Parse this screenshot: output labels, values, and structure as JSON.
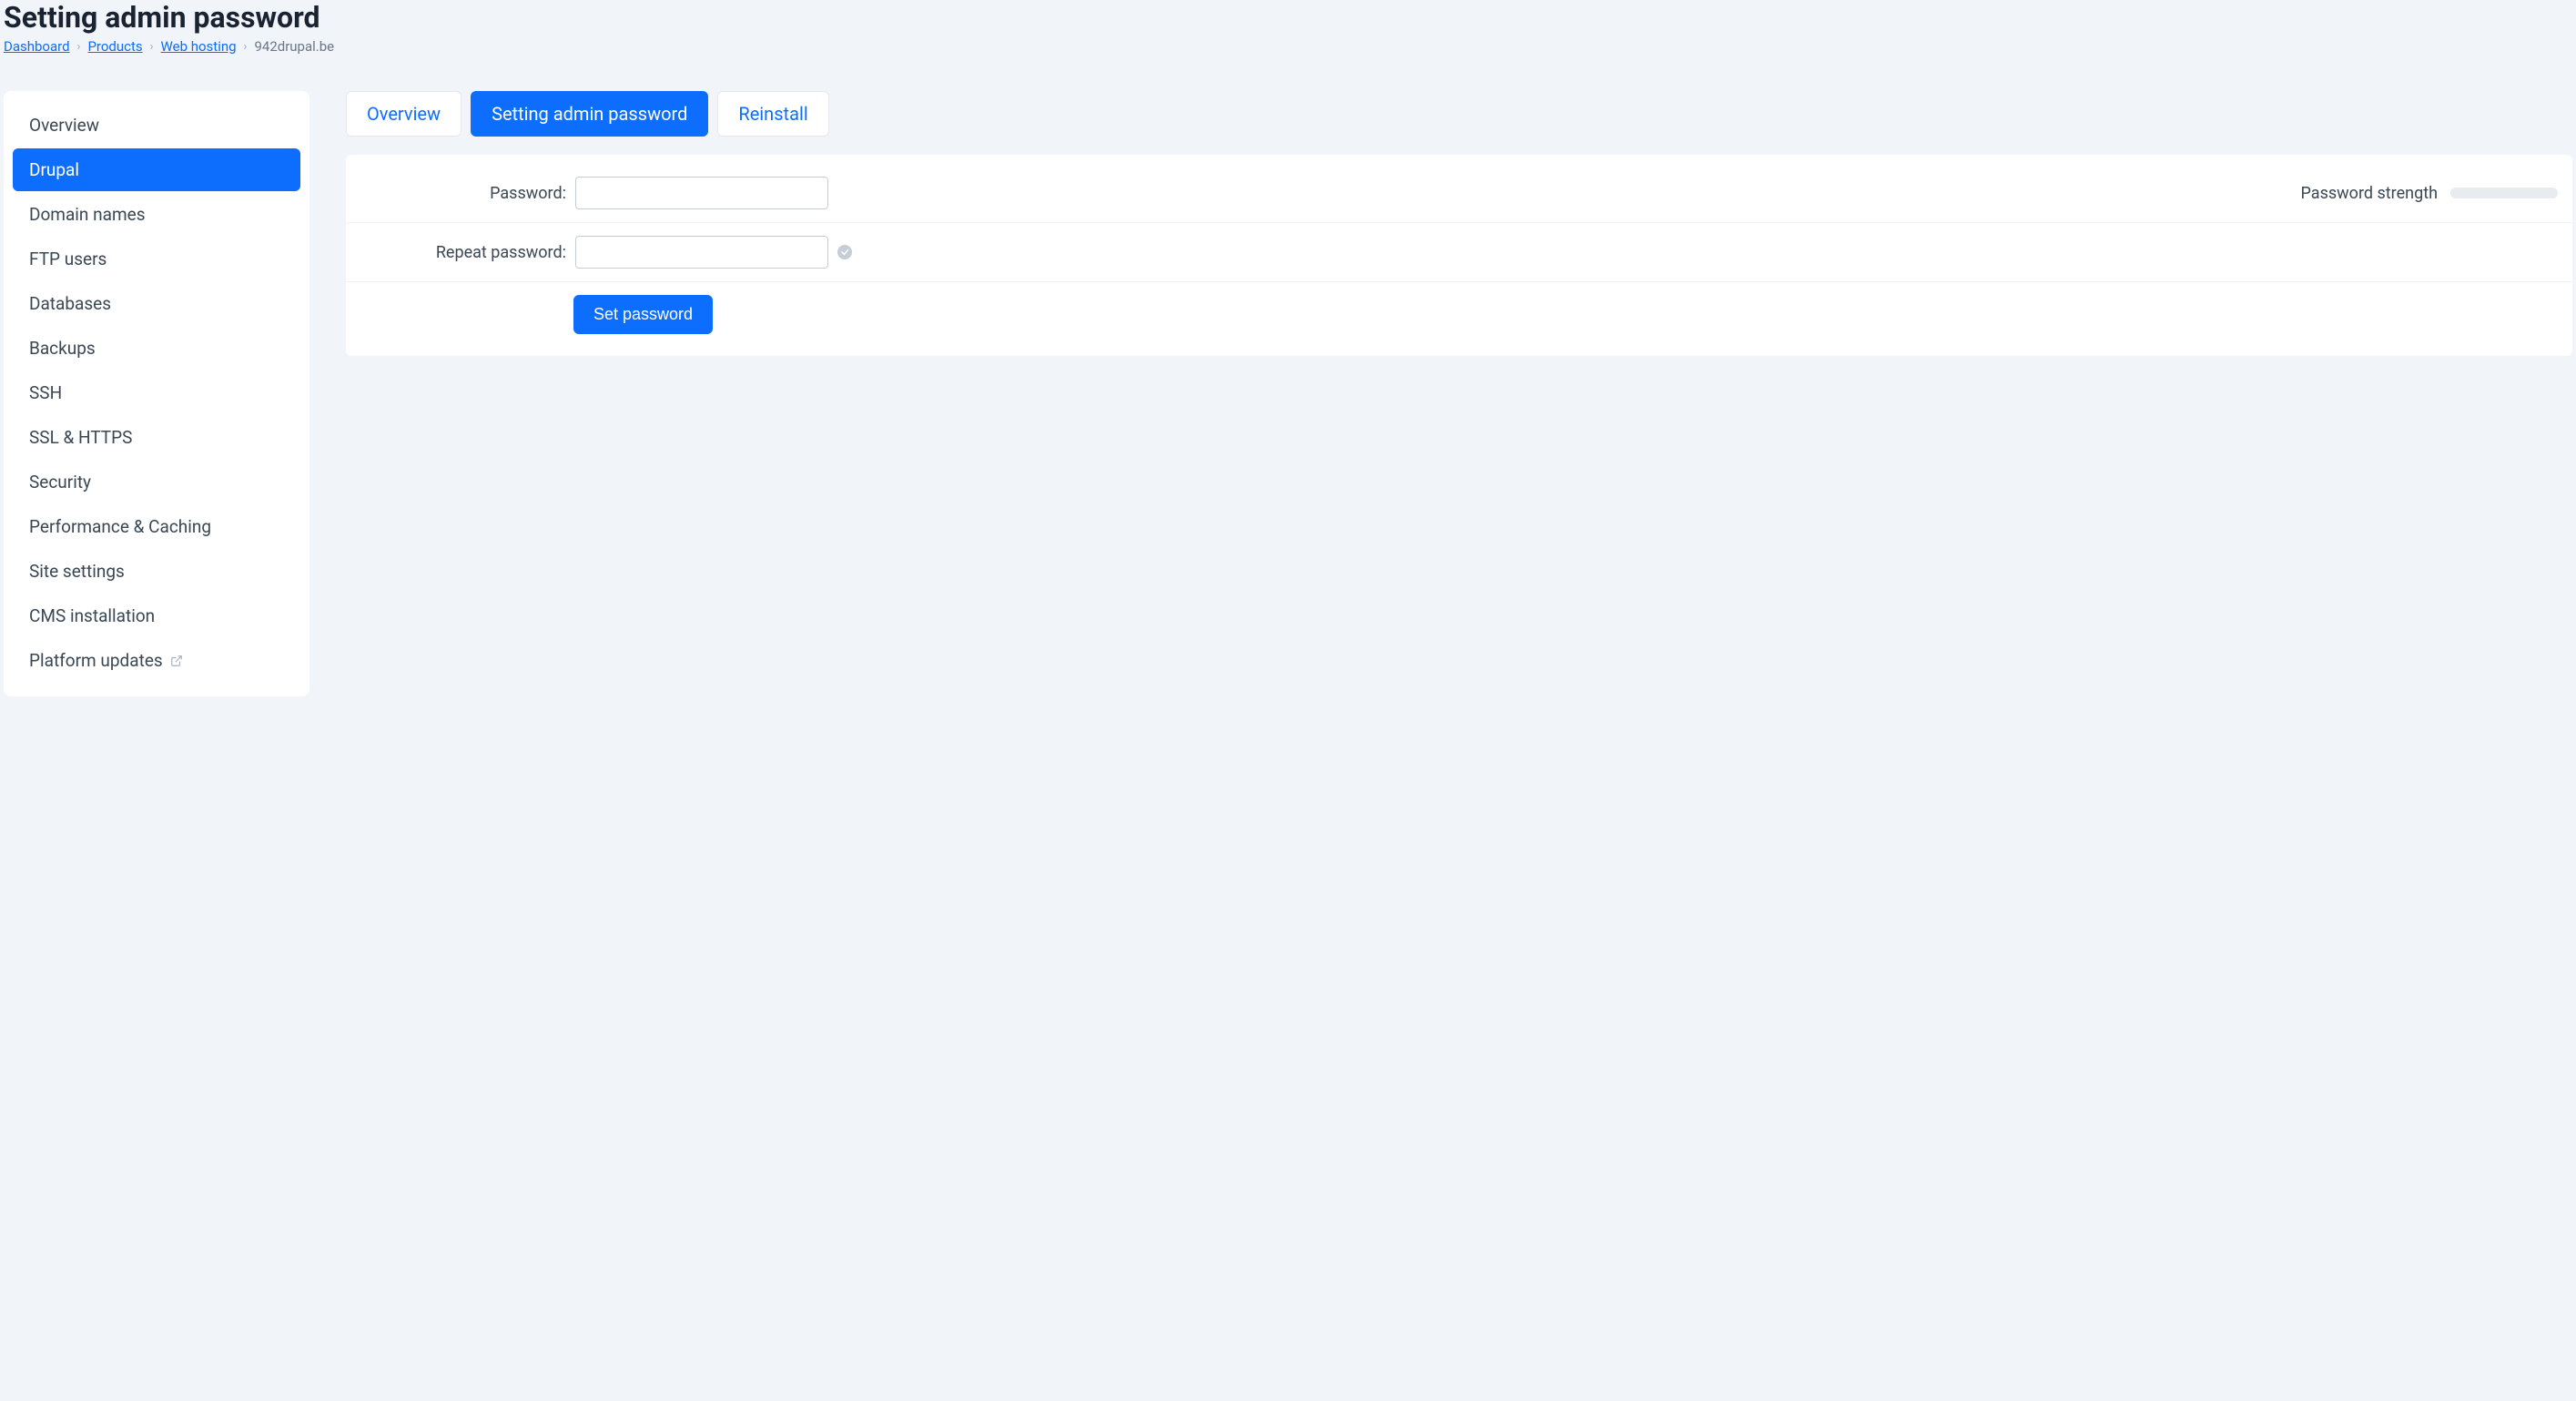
{
  "header": {
    "title": "Setting admin password"
  },
  "breadcrumb": {
    "items": [
      {
        "label": "Dashboard",
        "link": true
      },
      {
        "label": "Products",
        "link": true
      },
      {
        "label": "Web hosting",
        "link": true
      },
      {
        "label": "942drupal.be",
        "link": false
      }
    ]
  },
  "sidebar": {
    "items": [
      {
        "label": "Overview",
        "active": false,
        "external": false
      },
      {
        "label": "Drupal",
        "active": true,
        "external": false
      },
      {
        "label": "Domain names",
        "active": false,
        "external": false
      },
      {
        "label": "FTP users",
        "active": false,
        "external": false
      },
      {
        "label": "Databases",
        "active": false,
        "external": false
      },
      {
        "label": "Backups",
        "active": false,
        "external": false
      },
      {
        "label": "SSH",
        "active": false,
        "external": false
      },
      {
        "label": "SSL & HTTPS",
        "active": false,
        "external": false
      },
      {
        "label": "Security",
        "active": false,
        "external": false
      },
      {
        "label": "Performance & Caching",
        "active": false,
        "external": false
      },
      {
        "label": "Site settings",
        "active": false,
        "external": false
      },
      {
        "label": "CMS installation",
        "active": false,
        "external": false
      },
      {
        "label": "Platform updates",
        "active": false,
        "external": true
      }
    ]
  },
  "tabs": {
    "items": [
      {
        "label": "Overview",
        "active": false
      },
      {
        "label": "Setting admin password",
        "active": true
      },
      {
        "label": "Reinstall",
        "active": false
      }
    ]
  },
  "form": {
    "password_label": "Password:",
    "repeat_label": "Repeat password:",
    "strength_label": "Password strength",
    "submit_label": "Set password",
    "password_value": "",
    "repeat_value": ""
  }
}
